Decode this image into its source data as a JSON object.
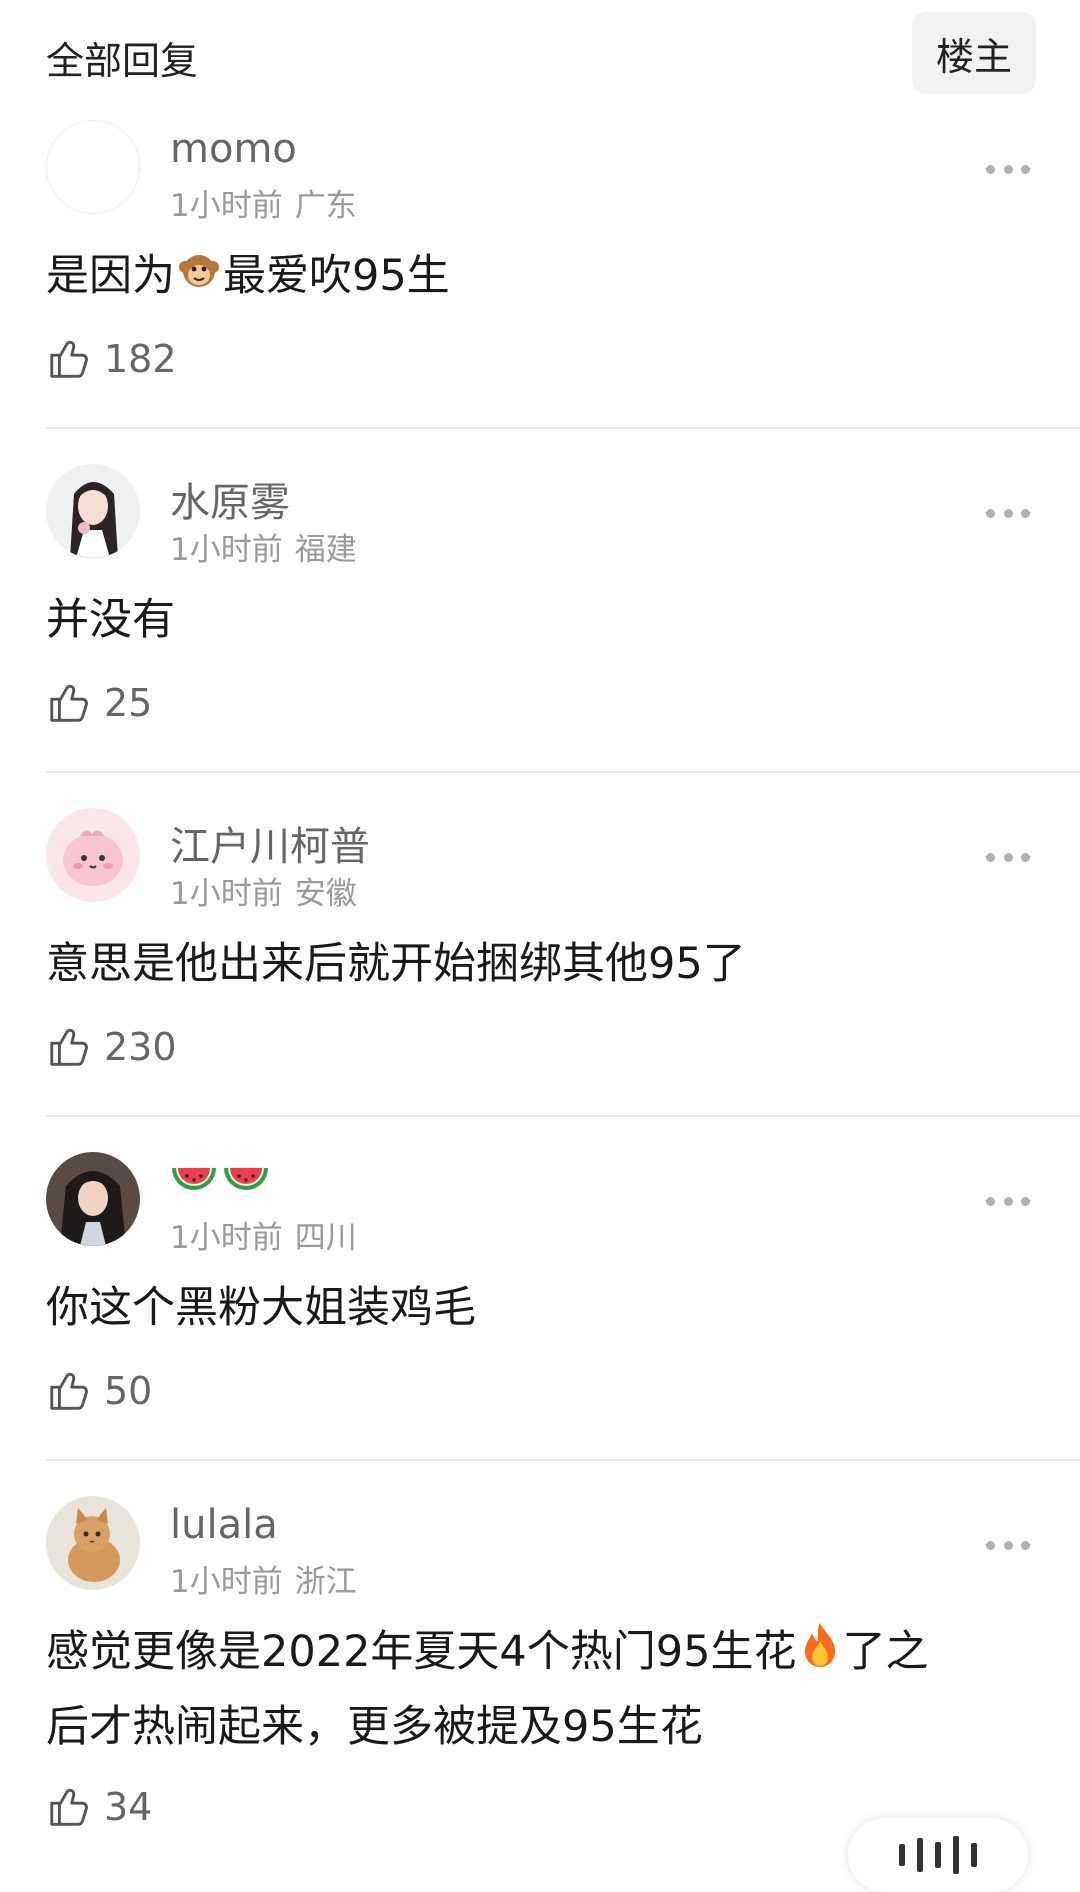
{
  "header": {
    "title": "全部回复",
    "owner_button": "楼主"
  },
  "comments": [
    {
      "username": "momo",
      "time": "1小时前",
      "location": "广东",
      "content_before": "是因为",
      "content_emoji": "monkey-emoji",
      "content_after": "最爱吹95生",
      "likes": "182"
    },
    {
      "username": "水原雾",
      "time": "1小时前",
      "location": "福建",
      "content": "并没有",
      "likes": "25"
    },
    {
      "username": "江户川柯普",
      "time": "1小时前",
      "location": "安徽",
      "content": "意思是他出来后就开始捆绑其他95了",
      "likes": "230"
    },
    {
      "username_emojis": [
        "watermelon-emoji",
        "watermelon-emoji"
      ],
      "time": "1小时前",
      "location": "四川",
      "content": "你这个黑粉大姐装鸡毛",
      "likes": "50"
    },
    {
      "username": "lulala",
      "time": "1小时前",
      "location": "浙江",
      "content_line1_before": "感觉更像是2022年夏天4个热门95生花",
      "content_line1_emoji": "fire-emoji",
      "content_line1_after": "了之",
      "content_line2": "后才热闹起来，更多被提及95生花",
      "likes": "34"
    }
  ]
}
